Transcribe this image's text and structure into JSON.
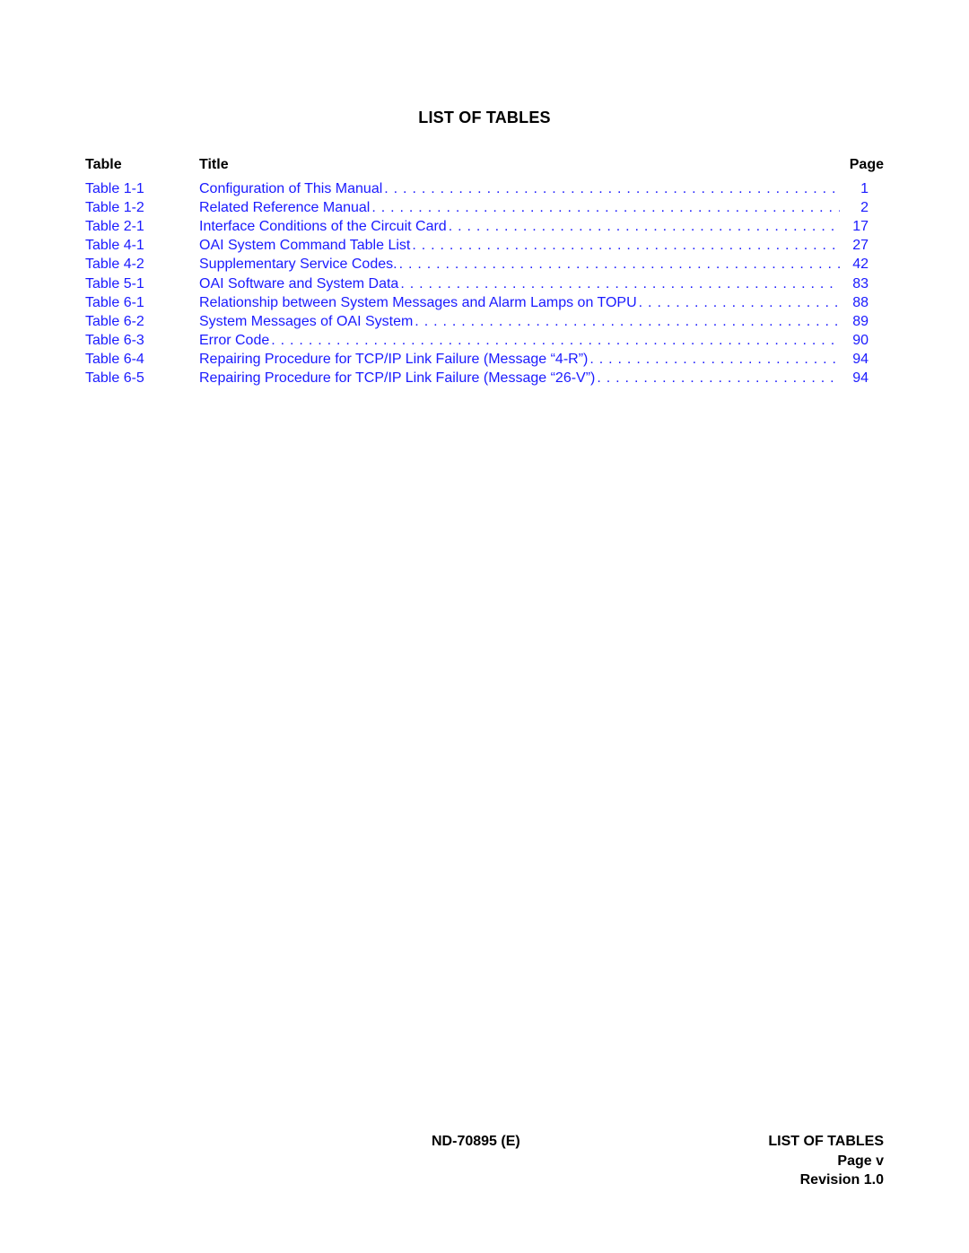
{
  "page": {
    "title": "LIST OF TABLES",
    "link_color": "#1a1aff"
  },
  "toc": {
    "headers": {
      "table": "Table",
      "title": "Title",
      "page": "Page"
    },
    "rows": [
      {
        "table": "Table 1-1",
        "title": "Configuration of This Manual",
        "page": "1"
      },
      {
        "table": "Table 1-2",
        "title": "Related Reference Manual ",
        "page": "2"
      },
      {
        "table": "Table 2-1",
        "title": "Interface Conditions of the Circuit Card",
        "page": "17"
      },
      {
        "table": "Table 4-1",
        "title": "OAI System Command Table List ",
        "page": "27"
      },
      {
        "table": "Table 4-2",
        "title": "Supplementary Service Codes.",
        "page": "42"
      },
      {
        "table": "Table 5-1",
        "title": "OAI Software and System Data",
        "page": "83"
      },
      {
        "table": "Table 6-1",
        "title": "Relationship between System Messages and Alarm Lamps on TOPU",
        "page": "88"
      },
      {
        "table": "Table 6-2",
        "title": "System Messages of OAI System ",
        "page": "89"
      },
      {
        "table": "Table 6-3",
        "title": "Error Code",
        "page": "90"
      },
      {
        "table": "Table 6-4",
        "title": "Repairing Procedure for TCP/IP Link Failure (Message “4-R”) ",
        "page": "94"
      },
      {
        "table": "Table 6-5",
        "title": "Repairing Procedure for TCP/IP Link Failure (Message “26-V”) ",
        "page": "94"
      }
    ]
  },
  "footer": {
    "doc_id": "ND-70895 (E)",
    "section": "LIST OF TABLES",
    "page_label": "Page v",
    "revision": "Revision 1.0"
  }
}
